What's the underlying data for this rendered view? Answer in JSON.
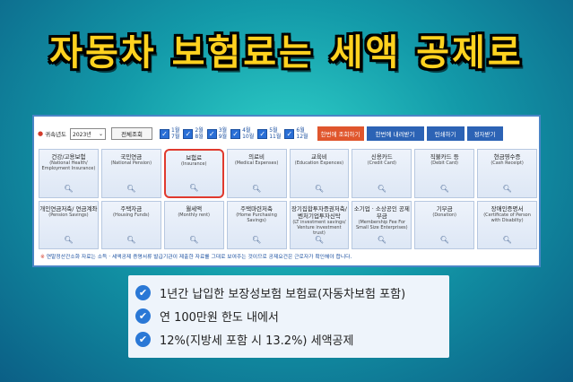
{
  "headline": "자동차 보험료는 세액 공제로",
  "filters": {
    "year_label": "귀속년도",
    "year_value": "2023년",
    "year_chevron": "⌄",
    "all_query_label": "전체조회",
    "months": [
      {
        "top": "1월",
        "bottom": "7월"
      },
      {
        "top": "2월",
        "bottom": "8월"
      },
      {
        "top": "3월",
        "bottom": "9월"
      },
      {
        "top": "4월",
        "bottom": "10월"
      },
      {
        "top": "5월",
        "bottom": "11월"
      },
      {
        "top": "6월",
        "bottom": "12월"
      }
    ],
    "buttons": {
      "view_once": "한번에 조회하기",
      "download_once": "한번에 내려받기",
      "print": "인쇄하기",
      "pdf": "정자받기"
    }
  },
  "tiles": [
    {
      "title": "건강/고용보험",
      "sub": "(National Health/ Employment Insurance)"
    },
    {
      "title": "국민연금",
      "sub": "(National Pension)"
    },
    {
      "title": "보험료",
      "sub": "(Insurance)",
      "highlight": true
    },
    {
      "title": "의료비",
      "sub": "(Medical Expenses)"
    },
    {
      "title": "교육비",
      "sub": "(Education Expences)"
    },
    {
      "title": "신용카드",
      "sub": "(Credit Card)"
    },
    {
      "title": "직불카드 등",
      "sub": "(Debit Card)"
    },
    {
      "title": "현금영수증",
      "sub": "(Cash Receipt)"
    },
    {
      "title": "개인연금저축/ 연금계좌",
      "sub": "(Pension Savings)"
    },
    {
      "title": "주택자금",
      "sub": "(Housing Funds)"
    },
    {
      "title": "월세액",
      "sub": "(Monthly rent)"
    },
    {
      "title": "주택마련저축",
      "sub": "(Home Purchasing Savings)"
    },
    {
      "title": "장기집합투자증권저축/ 벤처기업투자신탁",
      "sub": "(LT investment savings/ Venture investment trust)"
    },
    {
      "title": "소기업 · 소상공인 공제부금",
      "sub": "(Membership Fee For Small Size Enterprises)"
    },
    {
      "title": "기부금",
      "sub": "(Donation)"
    },
    {
      "title": "장애인증명서",
      "sub": "(Certificate of Person with Disabilty)"
    }
  ],
  "footnote_mark": "※",
  "footnote": "연말정산간소화 자료는 소득 · 세액공제 증명서류 발급기관이 제출한 자료를 그대로 보여주는 것이므로 공제요건은 근로자가 확인해야 합니다.",
  "info": [
    "1년간 납입한 보장성보험 보험료(자동차보험 포함)",
    "연 100만원 한도 내에서",
    "12%(지방세 포함 시 13.2%) 세액공제"
  ],
  "colors": {
    "headline": "#ffd21f",
    "accent_blue": "#2c63b5",
    "accent_orange": "#e0562d",
    "highlight_red": "#e03a2e"
  }
}
